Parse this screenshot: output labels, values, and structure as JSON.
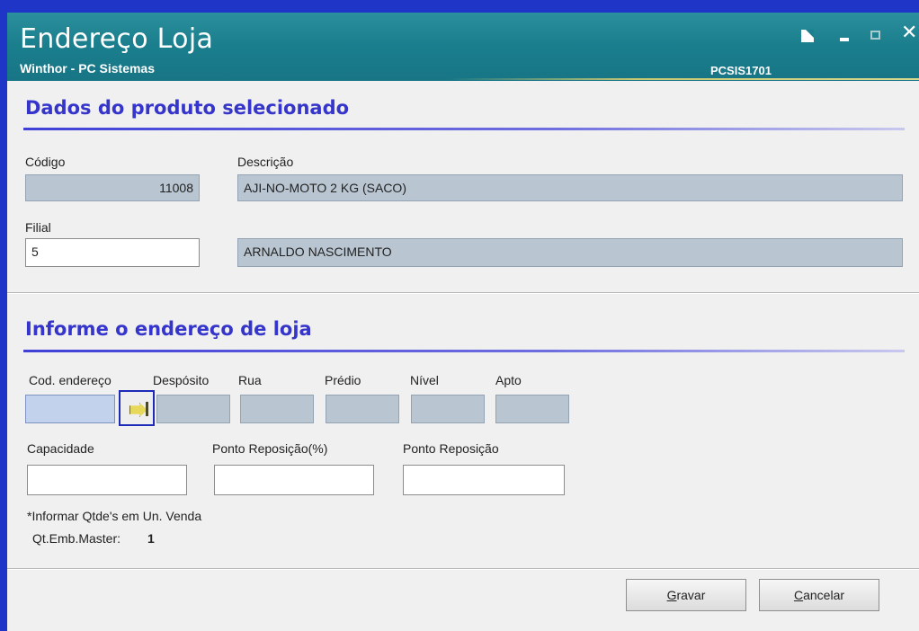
{
  "window": {
    "title": "Endereço Loja",
    "subtitle": "Winthor - PC Sistemas",
    "code": "PCSIS1701",
    "controls": {
      "close": "✕"
    }
  },
  "product_section": {
    "title": "Dados do produto selecionado",
    "codigo_label": "Código",
    "codigo_value": "11008",
    "descricao_label": "Descrição",
    "descricao_value": "AJI-NO-MOTO 2 KG (SACO)",
    "filial_label": "Filial",
    "filial_value": "5",
    "filial_name": "ARNALDO NASCIMENTO"
  },
  "address_section": {
    "title": "Informe o endereço de loja",
    "cod_endereco_label": "Cod. endereço",
    "deposito_label": "Despósito",
    "rua_label": "Rua",
    "predio_label": "Prédio",
    "nivel_label": "Nível",
    "apto_label": "Apto",
    "capacidade_label": "Capacidade",
    "ponto_reposicao_pct_label": "Ponto Reposição(%)",
    "ponto_reposicao_label": "Ponto Reposição",
    "note": "*Informar Qtde's em Un. Venda",
    "qt_emb_master_label": "Qt.Emb.Master:",
    "qt_emb_master_value": "1"
  },
  "buttons": {
    "gravar_first": "G",
    "gravar_rest": "ravar",
    "cancelar_first": "C",
    "cancelar_rest": "ancelar"
  },
  "icons": {
    "search": "search-arrow-icon"
  }
}
